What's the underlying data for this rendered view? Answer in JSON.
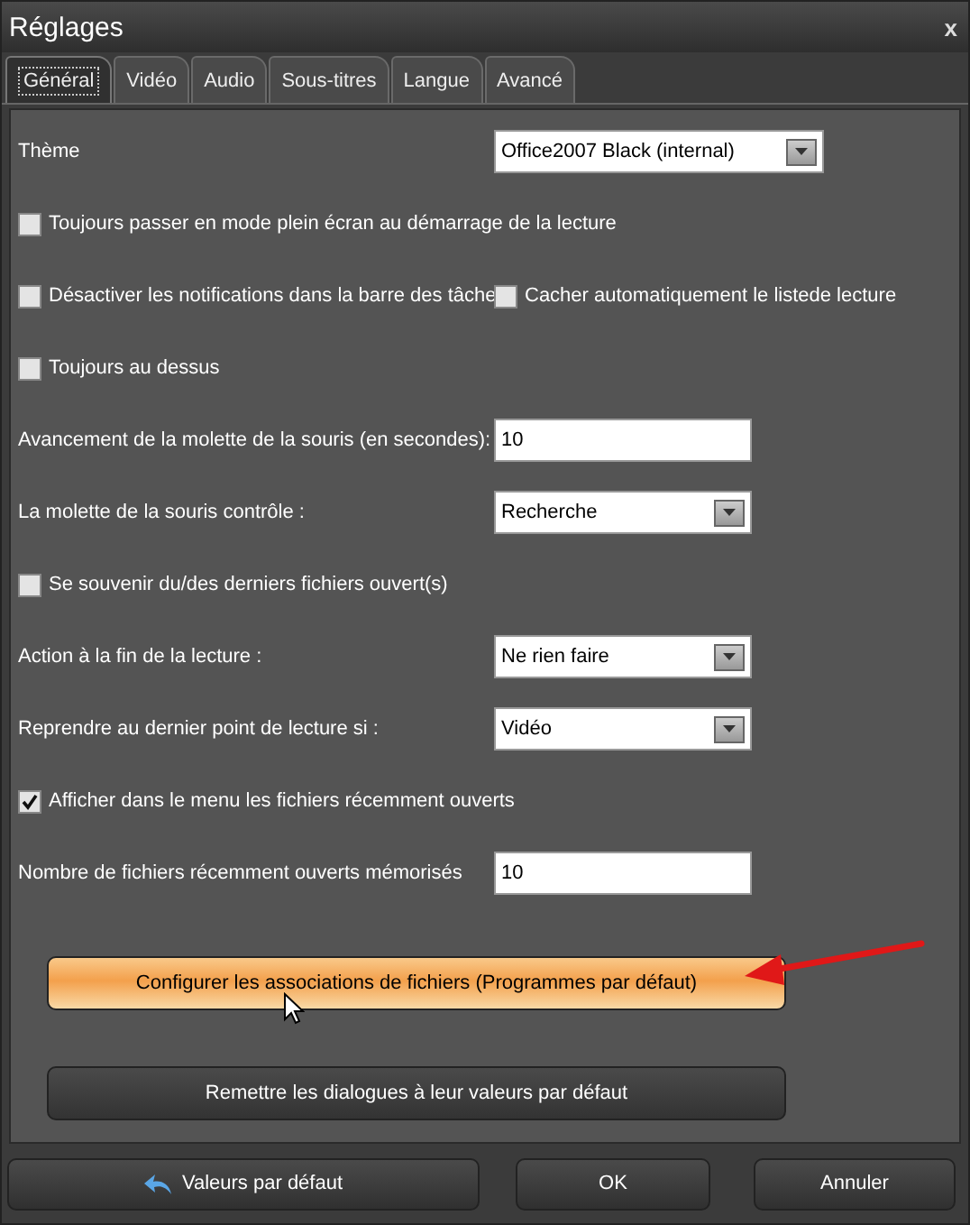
{
  "window": {
    "title": "Réglages",
    "close": "x"
  },
  "tabs": [
    {
      "label": "Général",
      "selected": true
    },
    {
      "label": "Vidéo",
      "selected": false
    },
    {
      "label": "Audio",
      "selected": false
    },
    {
      "label": "Sous-titres",
      "selected": false
    },
    {
      "label": "Langue",
      "selected": false
    },
    {
      "label": "Avancé",
      "selected": false
    }
  ],
  "theme": {
    "label": "Thème",
    "value": "Office2007 Black (internal)"
  },
  "rows": [
    {
      "kind": "checkbox",
      "label": "Toujours passer en mode plein écran au démarrage de la lecture",
      "checked": false
    },
    {
      "kind": "checkbox-pair",
      "label": "Désactiver les notifications dans la barre des tâche",
      "checked": false,
      "label_2": "Cacher automatiquement le listede lecture",
      "checked_2": false
    },
    {
      "kind": "checkbox",
      "label": "Toujours au dessus",
      "checked": false
    },
    {
      "kind": "input",
      "label": "Avancement de la molette de la souris (en secondes):",
      "value": "10"
    },
    {
      "kind": "dropdown",
      "label": "La molette de la souris contrôle :",
      "value": "Recherche"
    },
    {
      "kind": "checkbox",
      "label": "Se souvenir du/des derniers fichiers ouvert(s)",
      "checked": false
    },
    {
      "kind": "dropdown",
      "label": "Action à la fin de la lecture :",
      "value": "Ne rien faire"
    },
    {
      "kind": "dropdown",
      "label": "Reprendre au dernier point de lecture si :",
      "value": "Vidéo"
    },
    {
      "kind": "checkbox",
      "label": "Afficher dans le menu les fichiers récemment ouverts",
      "checked": true
    },
    {
      "kind": "input",
      "label": "Nombre de fichiers récemment ouverts mémorisés",
      "value": "10"
    }
  ],
  "actions": [
    {
      "label": "Configurer les associations de fichiers (Programmes par défaut)",
      "highlighted": true
    },
    {
      "label": "Remettre les dialogues à leur valeurs par défaut",
      "highlighted": false
    }
  ],
  "footer": [
    {
      "label": "Valeurs par défaut",
      "kind": "reset"
    },
    {
      "label": "OK",
      "kind": "plain"
    },
    {
      "label": "Annuler",
      "kind": "plain"
    }
  ]
}
